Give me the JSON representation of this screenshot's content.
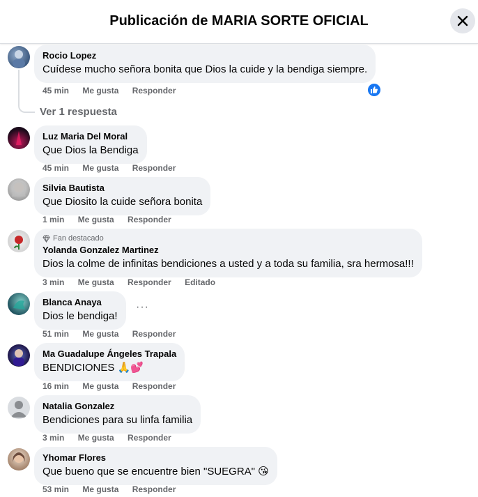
{
  "header": {
    "title": "Publicación de MARIA SORTE OFICIAL"
  },
  "actions": {
    "like": "Me gusta",
    "reply": "Responder",
    "edited": "Editado"
  },
  "replies_link": "Ver 1 respuesta",
  "comments": [
    {
      "name": "Rocio Lopez",
      "text": "Cuídese mucho señora bonita que Dios la cuide y la bendiga siempre.",
      "time": "45 min",
      "reaction": "like-icon"
    },
    {
      "name": "Luz Maria Del Moral",
      "text": "Que Dios la Bendiga",
      "time": "45 min"
    },
    {
      "name": "Silvia Bautista",
      "text": "Que Diosito la cuide señora bonita",
      "time": "1 min"
    },
    {
      "badge": "Fan destacado",
      "name": "Yolanda Gonzalez Martinez",
      "text": "Dios la colme de infinitas bendiciones a usted y a toda su familia, sra hermosa!!!",
      "time": "3 min"
    },
    {
      "name": "Blanca Anaya",
      "text": "Dios le bendiga!",
      "time": "51 min"
    },
    {
      "name": "Ma Guadalupe Ángeles Trapala",
      "text": "BENDICIONES 🙏💕",
      "time": "16 min"
    },
    {
      "name": "Natalia Gonzalez",
      "text": "Bendiciones para su linfa familia",
      "time": "3 min"
    },
    {
      "name": "Yhomar Flores",
      "text": "Que bueno que se encuentre bien \"SUEGRA\" 😘",
      "time": "53 min"
    }
  ],
  "colors": {
    "accent": "#1877f2",
    "bubble": "#f0f2f5",
    "muted": "#65676b"
  }
}
